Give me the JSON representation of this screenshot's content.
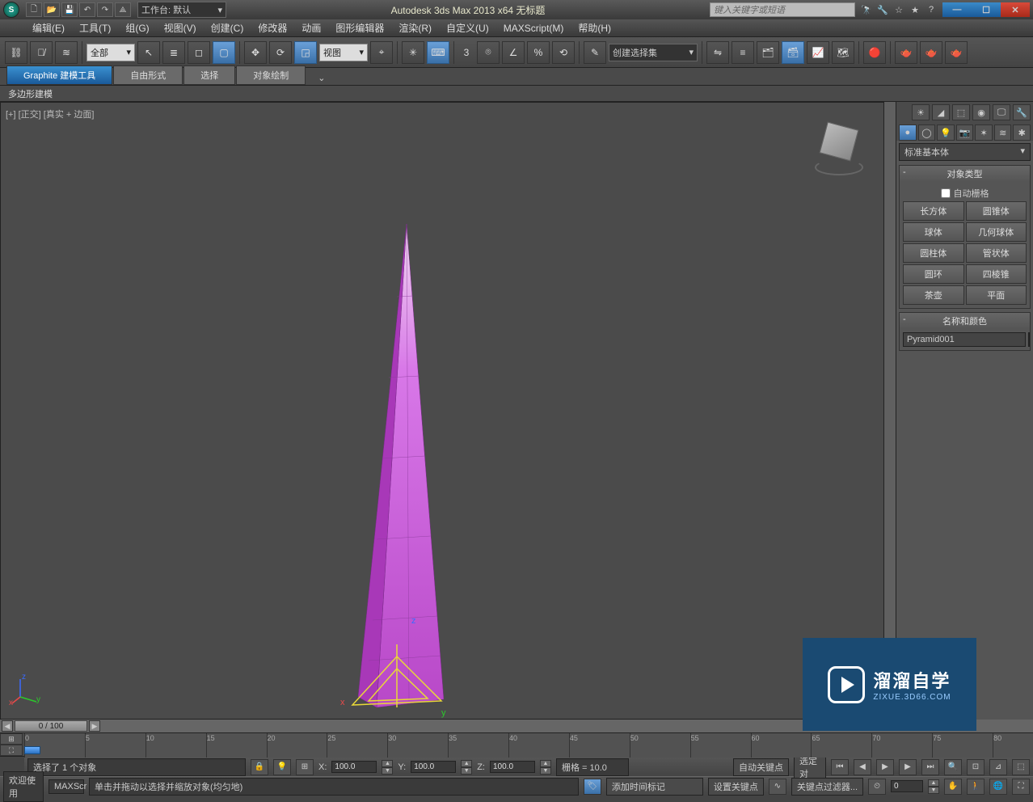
{
  "titlebar": {
    "workspace_label": "工作台: 默认",
    "app_title": "Autodesk 3ds Max  2013 x64     无标题",
    "search_placeholder": "键入关键字或短语"
  },
  "menubar": {
    "items": [
      "编辑(E)",
      "工具(T)",
      "组(G)",
      "视图(V)",
      "创建(C)",
      "修改器",
      "动画",
      "图形编辑器",
      "渲染(R)",
      "自定义(U)",
      "MAXScript(M)",
      "帮助(H)"
    ]
  },
  "toolbar": {
    "filter_label": "全部",
    "view_label": "视图",
    "axis_label": "3",
    "selset_label": "创建选择集"
  },
  "ribbon": {
    "tabs": [
      "Graphite 建模工具",
      "自由形式",
      "选择",
      "对象绘制"
    ],
    "sub": "多边形建模"
  },
  "viewport": {
    "label": "[+] [正交] [真实 + 边面]",
    "axes": {
      "x": "x",
      "y": "y",
      "z": "z"
    }
  },
  "cmdpanel": {
    "dropdown": "标准基本体",
    "rollout1_title": "对象类型",
    "autogrid_label": "自动栅格",
    "objects": [
      "长方体",
      "圆锥体",
      "球体",
      "几何球体",
      "圆柱体",
      "管状体",
      "圆环",
      "四棱锥",
      "茶壶",
      "平面"
    ],
    "rollout2_title": "名称和颜色",
    "object_name": "Pyramid001"
  },
  "timeline": {
    "slider_label": "0 / 100",
    "ticks": [
      "0",
      "5",
      "10",
      "15",
      "20",
      "25",
      "30",
      "35",
      "40",
      "45",
      "50",
      "55",
      "60",
      "65",
      "70",
      "75",
      "80"
    ]
  },
  "status1": {
    "selection": "选择了 1 个对象",
    "x_label": "X:",
    "x_val": "100.0",
    "y_label": "Y:",
    "y_val": "100.0",
    "z_label": "Z:",
    "z_val": "100.0",
    "grid": "栅格 = 10.0",
    "autokey": "自动关键点",
    "seldep": "选定对"
  },
  "status2": {
    "welcome": "欢迎使用",
    "maxscr": "MAXScr",
    "hint": "单击并拖动以选择并缩放对象(均匀地)",
    "addmarker": "添加时间标记",
    "setkey": "设置关键点",
    "keyfilter": "关键点过滤器...",
    "frame": "0"
  },
  "watermark": {
    "big": "溜溜自学",
    "small": "ZIXUE.3D66.COM"
  }
}
